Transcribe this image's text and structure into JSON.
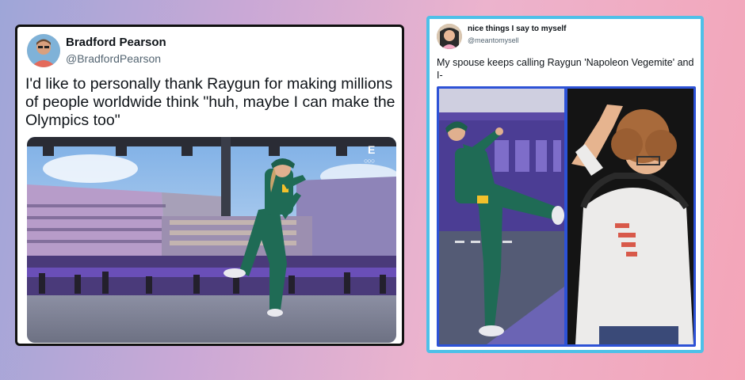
{
  "tweet1": {
    "name": "Bradford Pearson",
    "handle": "@BradfordPearson",
    "text": "I'd like to personally thank Raygun for making millions of people worldwide think \"huh, maybe I can make the Olympics too\"",
    "logo": "E",
    "logo_sub": "○○○"
  },
  "tweet2": {
    "name": "nice things I say to myself",
    "handle": "@meantomysell",
    "text": "My spouse keeps calling Raygun 'Napoleon Vegemite' and I-"
  },
  "colors": {
    "tweet2_border": "#4ec0e8",
    "media2_frame": "#2d52d6",
    "uniform_green": "#1f6b55",
    "stage_purple": "#6a4fb8"
  }
}
